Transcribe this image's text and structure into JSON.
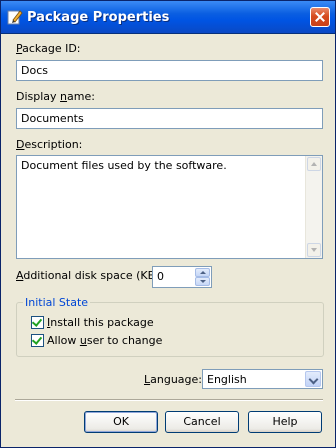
{
  "window": {
    "title": "Package Properties",
    "icon": "edit-pencil-icon"
  },
  "fields": {
    "package_id": {
      "label_underlined": "P",
      "label_rest": "ackage ID:",
      "value": "Docs"
    },
    "display_name": {
      "label_pre": "Display ",
      "label_underlined": "n",
      "label_rest": "ame:",
      "value": "Documents"
    },
    "description": {
      "label_underlined": "D",
      "label_rest": "escription:",
      "value": "Document files used by the software."
    },
    "disk_space": {
      "label_underlined": "A",
      "label_rest": "dditional disk space (KB):",
      "value": "0"
    }
  },
  "initial_state": {
    "legend": "Initial State",
    "install": {
      "label_underlined": "I",
      "label_rest": "nstall this package",
      "checked": true
    },
    "allow": {
      "label_pre": "Allow ",
      "label_underlined": "u",
      "label_rest": "ser to change",
      "checked": true
    }
  },
  "language": {
    "label_underlined": "L",
    "label_rest": "anguage:",
    "value": "English"
  },
  "buttons": {
    "ok": "OK",
    "cancel": "Cancel",
    "help": "Help"
  },
  "colors": {
    "titlebar": "#0054e3",
    "dialog_bg": "#ece9d8",
    "group_legend": "#0046d5",
    "checkmark": "#21a121"
  }
}
